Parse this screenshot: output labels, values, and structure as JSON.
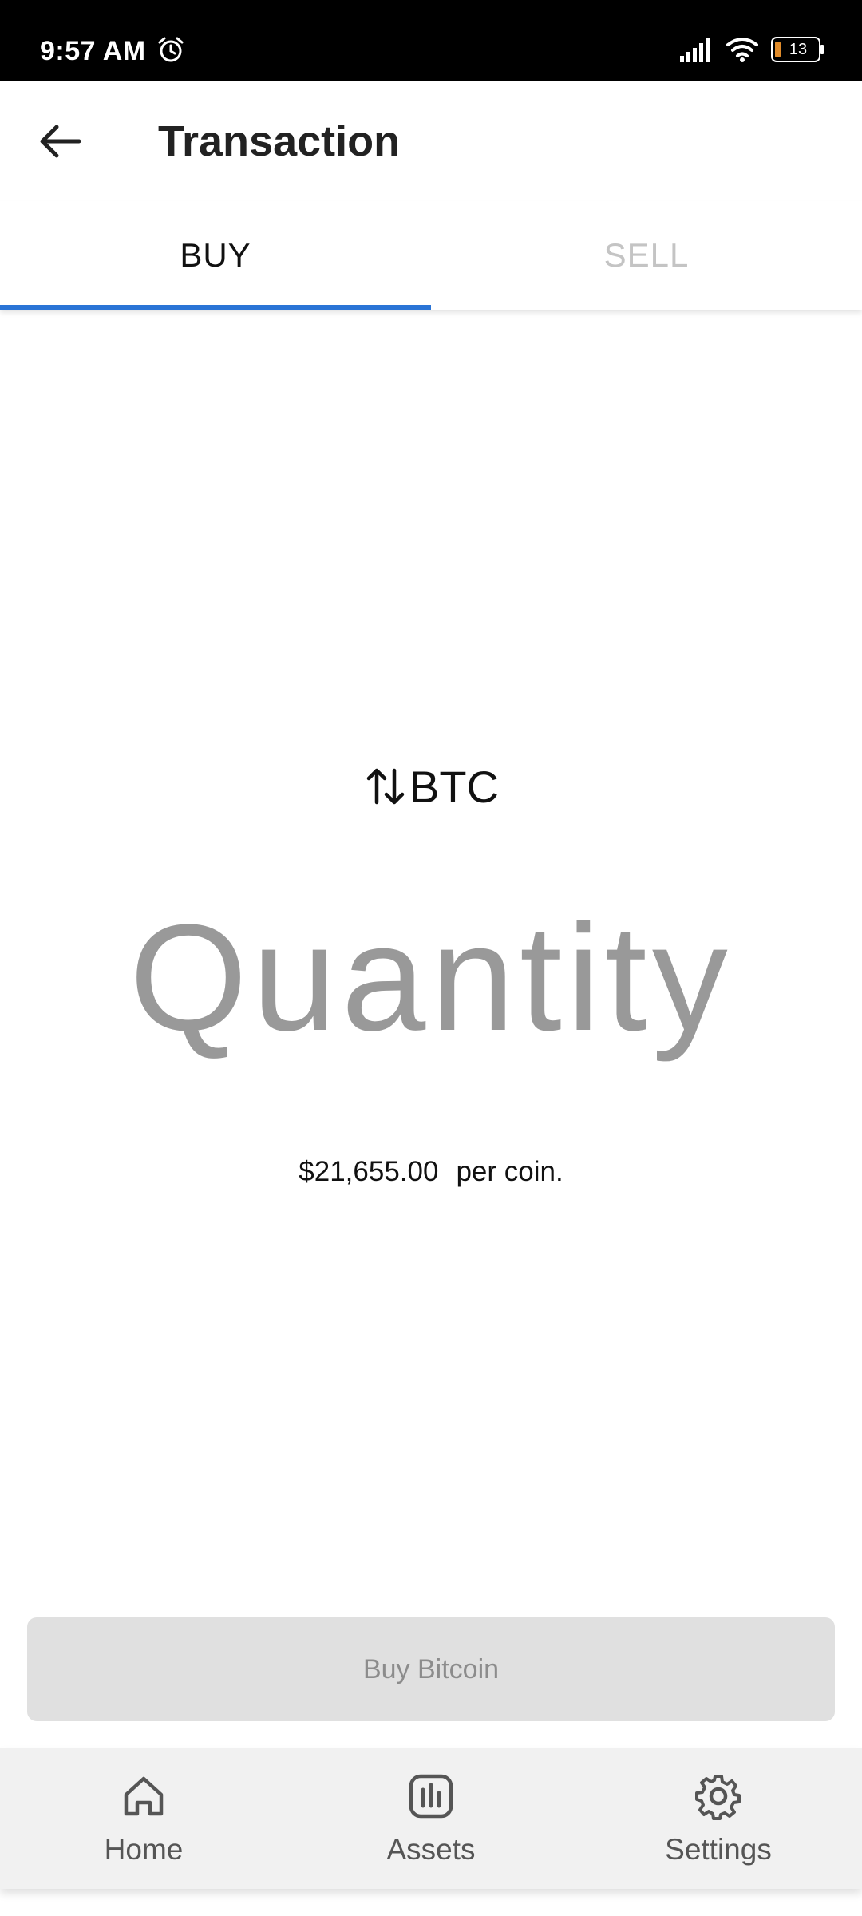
{
  "status_bar": {
    "time": "9:57 AM",
    "battery": "13",
    "icons": [
      "alarm-icon",
      "signal-icon",
      "wifi-icon",
      "battery-icon"
    ]
  },
  "header": {
    "title": "Transaction",
    "back_icon": "arrow-left-icon"
  },
  "tabs": [
    {
      "label": "BUY",
      "active": true
    },
    {
      "label": "SELL",
      "active": false
    }
  ],
  "main": {
    "currency": "BTC",
    "swap_icon": "swap-vertical-icon",
    "quantity_placeholder": "Quantity",
    "price": "$21,655.00",
    "price_suffix": "per coin."
  },
  "action_button": {
    "label": "Buy Bitcoin",
    "enabled": false
  },
  "bottom_nav": [
    {
      "label": "Home",
      "icon": "home-icon"
    },
    {
      "label": "Assets",
      "icon": "bar-chart-icon"
    },
    {
      "label": "Settings",
      "icon": "gear-icon"
    }
  ],
  "colors": {
    "accent": "#2a74d6",
    "quantity_text": "#999999",
    "disabled_button": "#e0e0e0"
  }
}
